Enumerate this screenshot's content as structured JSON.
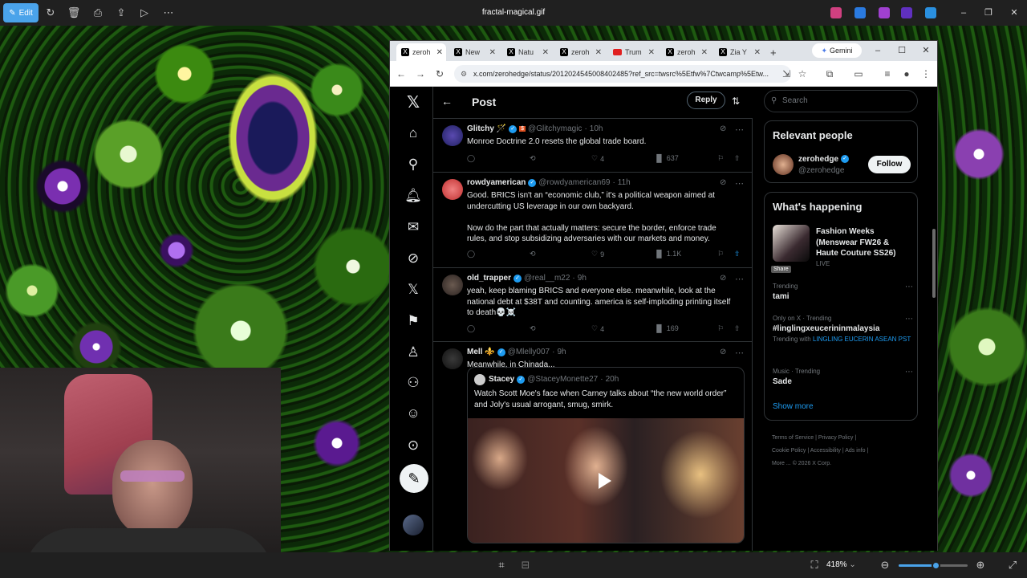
{
  "viewer": {
    "edit_label": "Edit",
    "filename": "fractal-magical.gif",
    "zoom": "418%",
    "zoom_level": 0.55
  },
  "tabs": [
    {
      "label": "zeroh",
      "favicon": "x-icon"
    },
    {
      "label": "New",
      "favicon": "x-icon"
    },
    {
      "label": "Natu",
      "favicon": "x-icon"
    },
    {
      "label": "zeroh",
      "favicon": "x-icon"
    },
    {
      "label": "Trum",
      "favicon": "youtube-icon"
    },
    {
      "label": "zeroh",
      "favicon": "x-icon"
    },
    {
      "label": "Zia Y",
      "favicon": "x-icon"
    }
  ],
  "gemini_label": "Gemini",
  "url": "x.com/zerohedge/status/2012024545008402485?ref_src=twsrc%5Etfw%7Ctwcamp%5Etw...",
  "post_header": {
    "title": "Post",
    "reply_label": "Reply"
  },
  "tweets": [
    {
      "name": "Glitchy 🪄",
      "handle": "@Glitchymagic",
      "time": "10h",
      "lines": [
        "Monroe Doctrine 2.0 resets the global trade board."
      ],
      "replies": "",
      "reposts": "",
      "likes": "4",
      "views": "637"
    },
    {
      "name": "rowdyamerican",
      "handle": "@rowdyamerican69",
      "time": "11h",
      "lines": [
        "Good. BRICS isn't an “economic club,” it's a political weapon aimed at",
        "undercutting US leverage in our own backyard.",
        "",
        "Now do the part that actually matters: secure the border, enforce trade",
        "rules, and stop subsidizing adversaries with our markets and money."
      ],
      "replies": "",
      "reposts": "",
      "likes": "9",
      "views": "1.1K"
    },
    {
      "name": "old_trapper",
      "handle": "@real__m22",
      "time": "9h",
      "lines": [
        "yeah, keep blaming BRICS and everyone else. meanwhile, look at the",
        "national debt at $38T and counting. america is self-imploding printing itself",
        "to death💀☠️"
      ],
      "replies": "",
      "reposts": "",
      "likes": "4",
      "views": "169"
    },
    {
      "name": "Mell ⚜️",
      "handle": "@Mlelly007",
      "time": "9h",
      "lines": [
        "Meanwhile, in Chinada..."
      ],
      "quote": {
        "name": "Stacey",
        "handle": "@StaceyMonette27",
        "time": "20h",
        "lines": [
          "Watch Scott Moe's face when Carney talks about “the new world order”",
          "and Joly's usual arrogant, smug, smirk."
        ]
      }
    }
  ],
  "share_tooltip": "Share",
  "search_placeholder": "Search",
  "relevant": {
    "title": "Relevant people",
    "name": "zerohedge",
    "handle": "@zerohedge",
    "follow_label": "Follow"
  },
  "happening": {
    "title": "What's happening",
    "event": {
      "title": "Fashion Weeks (Menswear FW26 & Haute Couture SS26)",
      "status": "LIVE"
    },
    "trends": [
      {
        "meta": "Trending",
        "title": "tami"
      },
      {
        "meta": "Only on X · Trending",
        "title": "#linglingxeucerininmalaysia",
        "with_label": "Trending with",
        "with": "LINGLING EUCERIN ASEAN PST"
      },
      {
        "meta": "Music · Trending",
        "title": "Sade"
      }
    ],
    "show_more": "Show more"
  },
  "footer": [
    "Terms of Service",
    "Privacy Policy",
    "Cookie Policy",
    "Accessibility",
    "Ads info",
    "More ...",
    "© 2026 X Corp."
  ]
}
